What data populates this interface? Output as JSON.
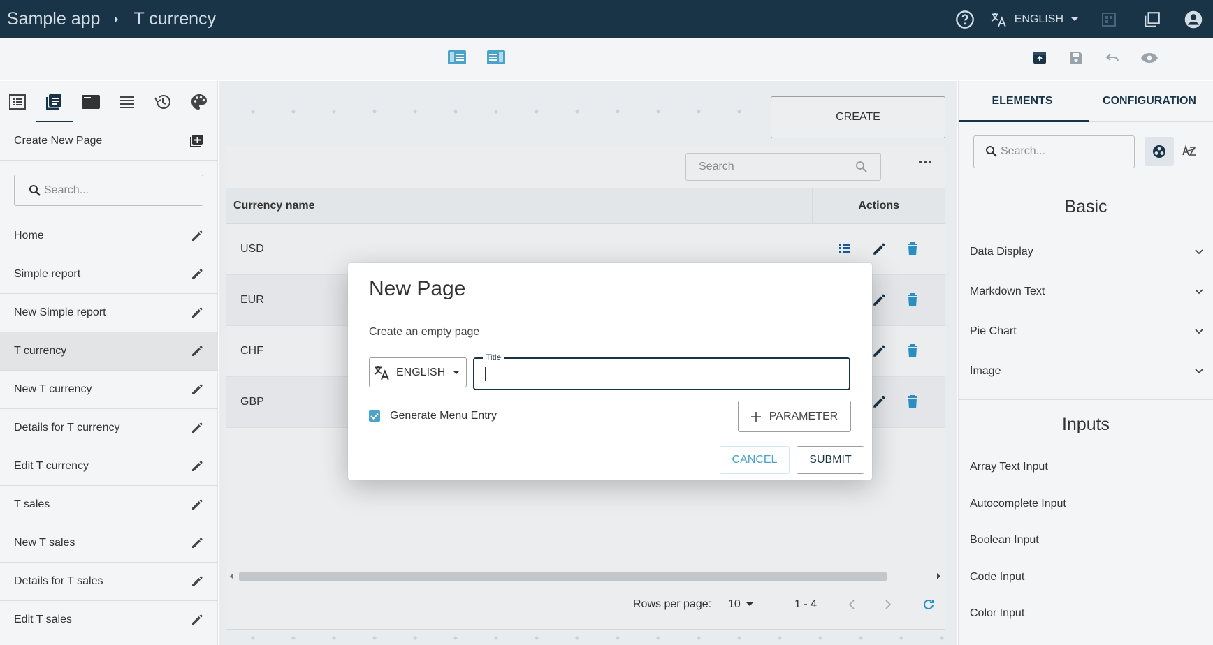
{
  "appbar": {
    "app_name": "Sample app",
    "page_name": "T currency",
    "language": "ENGLISH",
    "colors": {
      "bar": "#1a3447",
      "accent": "#4aa3c8"
    }
  },
  "sidebar": {
    "create_label": "Create New Page",
    "search_placeholder": "Search...",
    "items": [
      {
        "label": "Home"
      },
      {
        "label": "Simple report"
      },
      {
        "label": "New Simple report"
      },
      {
        "label": "T currency"
      },
      {
        "label": "New T currency"
      },
      {
        "label": "Details for T currency"
      },
      {
        "label": "Edit T currency"
      },
      {
        "label": "T sales"
      },
      {
        "label": "New T sales"
      },
      {
        "label": "Details for T sales"
      },
      {
        "label": "Edit T sales"
      }
    ]
  },
  "canvas": {
    "create_label": "CREATE",
    "search_placeholder": "Search",
    "columns": [
      "Currency name",
      "Actions"
    ],
    "rows": [
      "USD",
      "EUR",
      "CHF",
      "GBP"
    ],
    "rows_per_page_label": "Rows per page:",
    "rows_per_page": "10",
    "range": "1 - 4"
  },
  "rpanel": {
    "tabs": [
      "ELEMENTS",
      "CONFIGURATION"
    ],
    "search_placeholder": "Search...",
    "basic_title": "Basic",
    "basic_items": [
      "Data Display",
      "Markdown Text",
      "Pie Chart",
      "Image"
    ],
    "inputs_title": "Inputs",
    "inputs_items": [
      "Array Text Input",
      "Autocomplete Input",
      "Boolean Input",
      "Code Input",
      "Color Input"
    ]
  },
  "modal": {
    "title": "New Page",
    "subtitle": "Create an empty page",
    "language": "ENGLISH",
    "title_label": "Title",
    "title_value": "",
    "generate_label": "Generate Menu Entry",
    "generate_checked": true,
    "parameter_label": "PARAMETER",
    "cancel_label": "CANCEL",
    "submit_label": "SUBMIT"
  }
}
